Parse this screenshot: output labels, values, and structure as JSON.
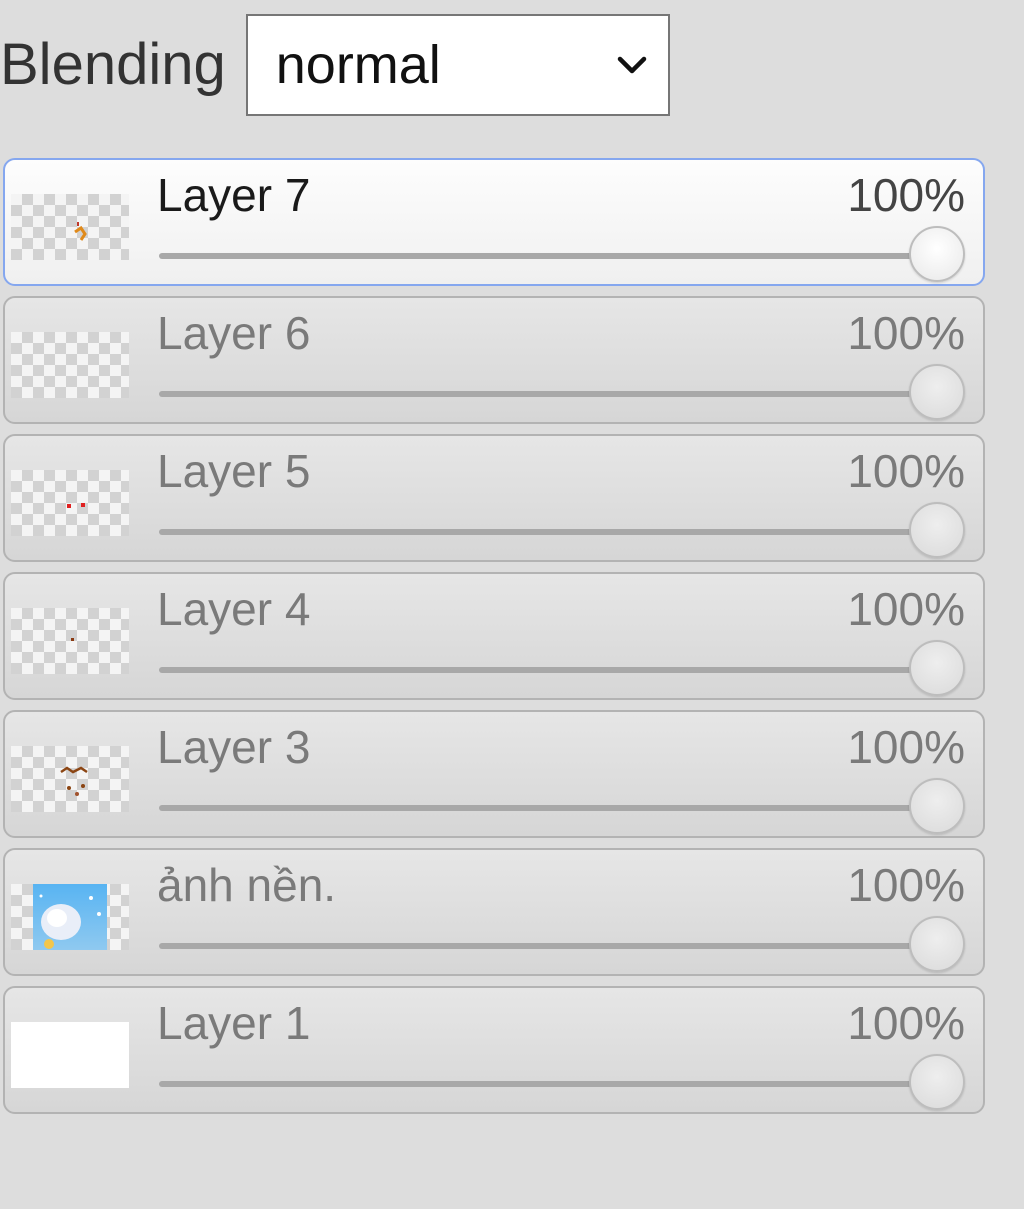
{
  "blending": {
    "label": "Blending",
    "value": "normal"
  },
  "layers": [
    {
      "name": "Layer 7",
      "opacity_label": "100%",
      "opacity": 1.0,
      "selected": true,
      "thumb": "layer7"
    },
    {
      "name": "Layer 6",
      "opacity_label": "100%",
      "opacity": 1.0,
      "selected": false,
      "thumb": "empty"
    },
    {
      "name": "Layer 5",
      "opacity_label": "100%",
      "opacity": 1.0,
      "selected": false,
      "thumb": "layer5"
    },
    {
      "name": "Layer 4",
      "opacity_label": "100%",
      "opacity": 1.0,
      "selected": false,
      "thumb": "layer4"
    },
    {
      "name": "Layer 3",
      "opacity_label": "100%",
      "opacity": 1.0,
      "selected": false,
      "thumb": "layer3"
    },
    {
      "name": "ảnh nền.",
      "opacity_label": "100%",
      "opacity": 1.0,
      "selected": false,
      "thumb": "background"
    },
    {
      "name": "Layer 1",
      "opacity_label": "100%",
      "opacity": 1.0,
      "selected": false,
      "thumb": "white"
    }
  ],
  "colors": {
    "selected_border": "#85a7ef",
    "panel_bg": "#dddddd"
  }
}
